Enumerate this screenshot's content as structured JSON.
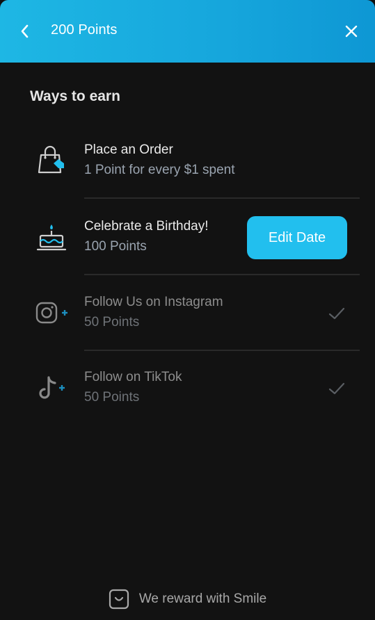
{
  "header": {
    "title": "200 Points",
    "back_icon": "chevron-left-icon",
    "close_icon": "close-icon",
    "colors": {
      "gradient_start": "#1eb7e4",
      "gradient_end": "#0e97d4"
    }
  },
  "section": {
    "title": "Ways to earn"
  },
  "earn_items": [
    {
      "title": "Place an Order",
      "subtitle": "1 Point for every $1 spent",
      "icon": "shopping-bag-icon"
    },
    {
      "title": "Celebrate a Birthday!",
      "subtitle": "100 Points",
      "icon": "birthday-cake-icon",
      "action_label": "Edit Date"
    },
    {
      "title": "Follow Us on Instagram",
      "subtitle": "50 Points",
      "icon": "instagram-icon",
      "status": "check-icon"
    },
    {
      "title": "Follow on TikTok",
      "subtitle": "50 Points",
      "icon": "tiktok-icon",
      "status": "check-icon"
    }
  ],
  "footer": {
    "text": "We reward with Smile",
    "icon": "smile-logo-icon"
  },
  "colors": {
    "accent": "#22bfee",
    "background": "#121212"
  }
}
